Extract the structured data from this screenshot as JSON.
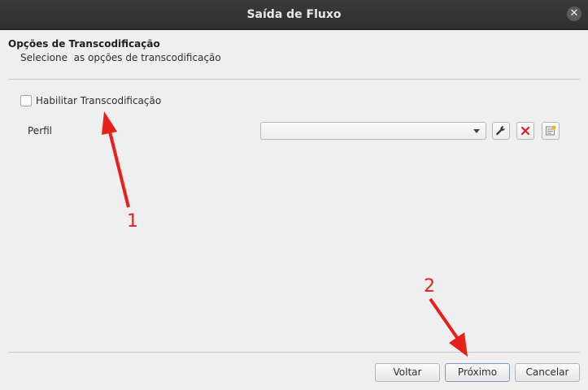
{
  "window": {
    "title": "Saída de Fluxo",
    "close_symbol": "✕"
  },
  "header": {
    "title": "Opções de Transcodificação",
    "subtitle": "Selecione  as opções de transcodificação"
  },
  "transcode": {
    "enable_label": "Habilitar Transcodificação",
    "enable_checked": false,
    "profile_label": "Perfil",
    "profile_value": ""
  },
  "tools": {
    "edit_icon": "wrench-icon",
    "delete_icon": "delete-x-icon",
    "new_icon": "new-profile-icon"
  },
  "footer": {
    "back_label": "Voltar",
    "next_label": "Próximo",
    "cancel_label": "Cancelar"
  },
  "annotations": {
    "first": "1",
    "second": "2",
    "color": "#e8201a"
  }
}
